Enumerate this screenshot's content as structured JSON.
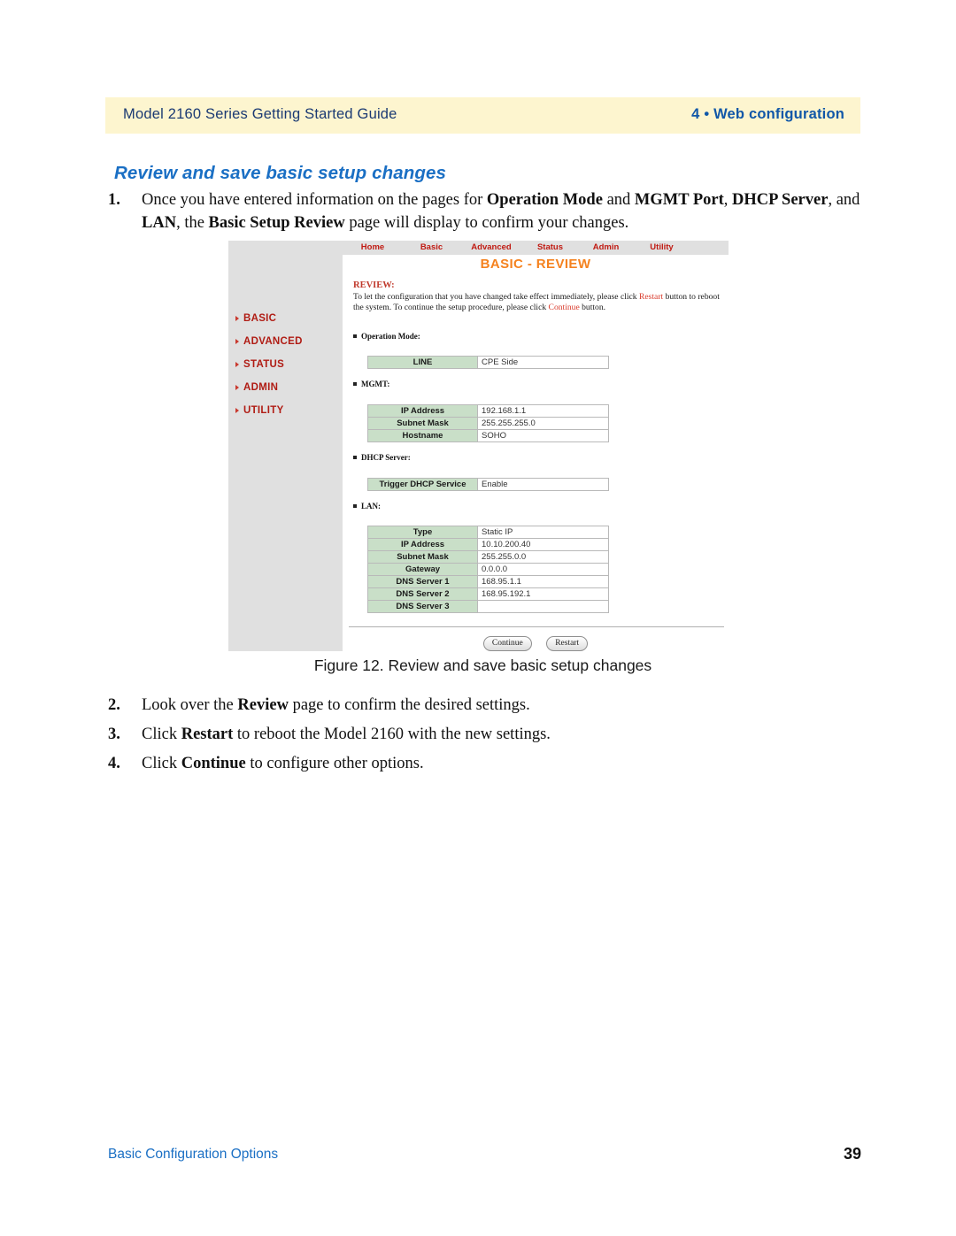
{
  "page_header": {
    "left_text": "Model 2160 Series Getting Started Guide",
    "right_text": "4 • Web configuration",
    "band_color": "#fdf5cf",
    "right_color": "#1057a8"
  },
  "section": {
    "heading": "Review and save basic setup changes",
    "heading_color": "#1a6fc4"
  },
  "steps": [
    {
      "number": "1.",
      "html": "Once you have entered information on the pages for <b>Operation Mode</b> and <b>MGMT Port</b>, <b>DHCP Server</b>, and <b>LAN</b>, the <b>Basic Setup Review</b> page will display to confirm your changes."
    },
    {
      "number": "2.",
      "html": "Look over the <b>Review</b> page to confirm the desired settings."
    },
    {
      "number": "3.",
      "html": "Click <b>Restart</b> to reboot the Model 2160 with the new settings."
    },
    {
      "number": "4.",
      "html": "Click <b>Continue</b> to configure other options."
    }
  ],
  "figure": {
    "caption": "Figure 12. Review and save basic setup changes"
  },
  "screenshot": {
    "nav_tabs": [
      {
        "label": "Home"
      },
      {
        "label": "Basic"
      },
      {
        "label": "Advanced"
      },
      {
        "label": "Status"
      },
      {
        "label": "Admin"
      },
      {
        "label": "Utility"
      }
    ],
    "nav_color": "#c01a12",
    "page_title": "BASIC - REVIEW",
    "page_title_color": "#f5821f",
    "sidebar_items": [
      {
        "label": "BASIC"
      },
      {
        "label": "ADVANCED"
      },
      {
        "label": "STATUS"
      },
      {
        "label": "ADMIN"
      },
      {
        "label": "UTILITY"
      }
    ],
    "sidebar_color": "#b01c14",
    "review": {
      "heading": "REVIEW:",
      "body_html": "To let the configuration that you have changed take effect immediately,  please click <span class=\"lnk\">Restart</span> button to reboot the system.  To continue the setup procedure, please click <span class=\"lnk\">Continue</span> button."
    },
    "sections": [
      {
        "label": "Operation Mode:",
        "rows": [
          {
            "key": "LINE",
            "value": "CPE Side"
          }
        ]
      },
      {
        "label": "MGMT:",
        "rows": [
          {
            "key": "IP Address",
            "value": "192.168.1.1"
          },
          {
            "key": "Subnet Mask",
            "value": "255.255.255.0"
          },
          {
            "key": "Hostname",
            "value": "SOHO"
          }
        ]
      },
      {
        "label": "DHCP Server:",
        "rows": [
          {
            "key": "Trigger DHCP Service",
            "value": "Enable"
          }
        ]
      },
      {
        "label": "LAN:",
        "rows": [
          {
            "key": "Type",
            "value": "Static IP"
          },
          {
            "key": "IP Address",
            "value": "10.10.200.40"
          },
          {
            "key": "Subnet Mask",
            "value": "255.255.0.0"
          },
          {
            "key": "Gateway",
            "value": "0.0.0.0"
          },
          {
            "key": "DNS Server 1",
            "value": "168.95.1.1"
          },
          {
            "key": "DNS Server 2",
            "value": "168.95.192.1"
          },
          {
            "key": "DNS Server 3",
            "value": ""
          }
        ]
      }
    ],
    "buttons": [
      {
        "label": "Continue"
      },
      {
        "label": "Restart"
      }
    ],
    "key_cell_color": "#c9dfc8"
  },
  "page_footer": {
    "left_text": "Basic Configuration Options",
    "page_number": "39",
    "left_color": "#1a6fc4"
  }
}
